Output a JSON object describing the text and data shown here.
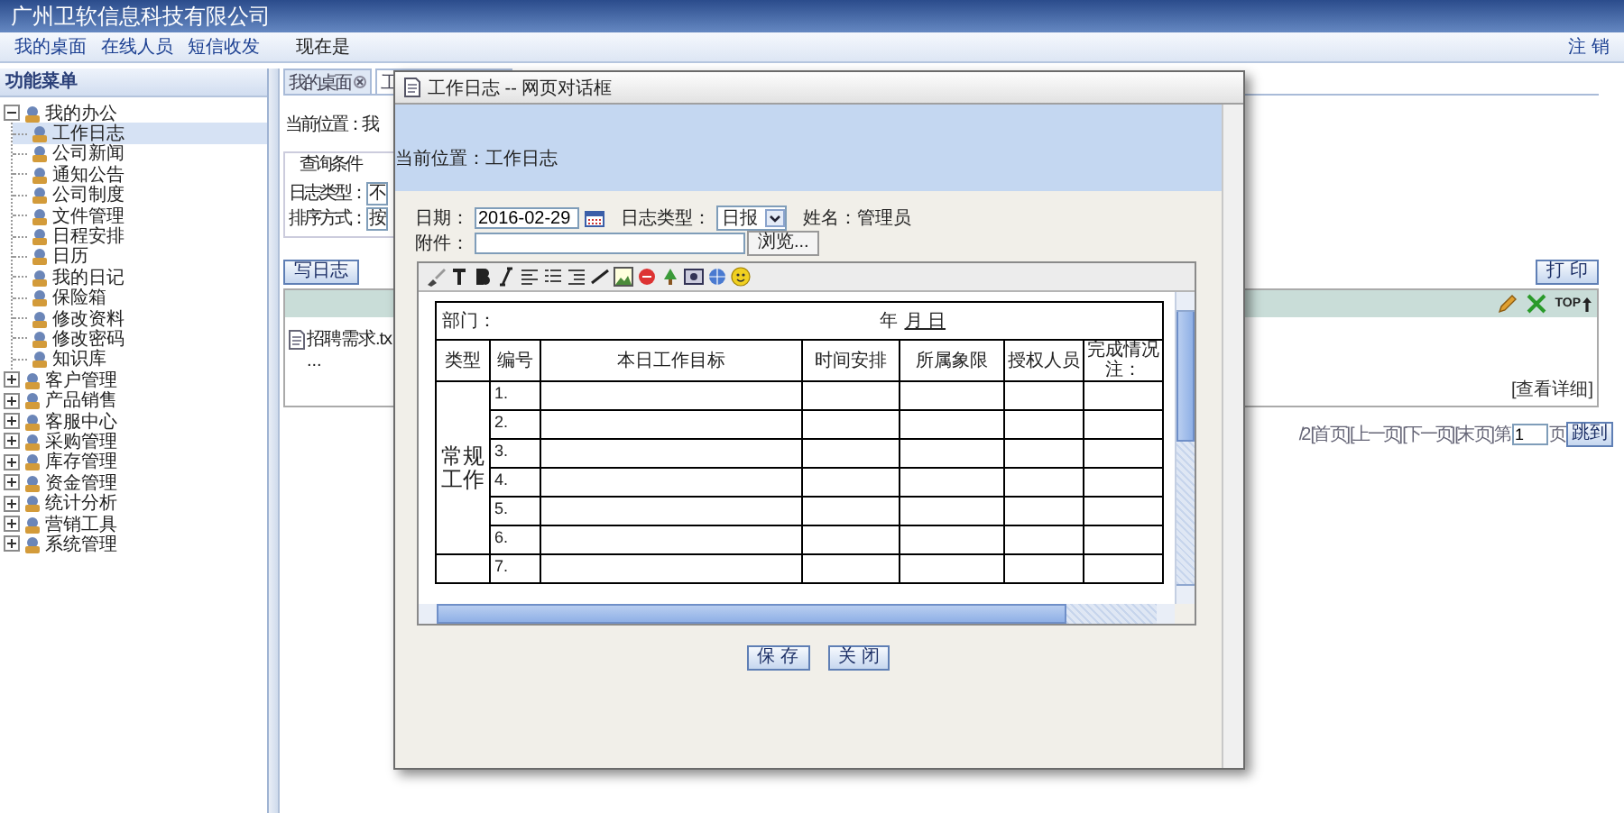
{
  "header": {
    "title": "广州卫软信息科技有限公司"
  },
  "nav": {
    "links": [
      "我的桌面",
      "在线人员",
      "短信收发"
    ],
    "clock_label": "现在是",
    "logout": "注 销"
  },
  "sidebar": {
    "title": "功能菜单",
    "items": [
      {
        "label": "我的办公",
        "expanded": true,
        "children": [
          {
            "label": "工作日志",
            "selected": true
          },
          {
            "label": "公司新闻",
            "selected": false
          },
          {
            "label": "通知公告",
            "selected": false
          },
          {
            "label": "公司制度",
            "selected": false
          },
          {
            "label": "文件管理",
            "selected": false
          },
          {
            "label": "日程安排",
            "selected": false
          },
          {
            "label": "日历",
            "selected": false
          },
          {
            "label": "我的日记",
            "selected": false
          },
          {
            "label": "保险箱",
            "selected": false
          },
          {
            "label": "修改资料",
            "selected": false
          },
          {
            "label": "修改密码",
            "selected": false
          },
          {
            "label": "知识库",
            "selected": false
          }
        ]
      },
      {
        "label": "客户管理",
        "expanded": false
      },
      {
        "label": "产品销售",
        "expanded": false
      },
      {
        "label": "客服中心",
        "expanded": false
      },
      {
        "label": "采购管理",
        "expanded": false
      },
      {
        "label": "库存管理",
        "expanded": false
      },
      {
        "label": "资金管理",
        "expanded": false
      },
      {
        "label": "统计分析",
        "expanded": false
      },
      {
        "label": "营销工具",
        "expanded": false
      },
      {
        "label": "系统管理",
        "expanded": false
      }
    ]
  },
  "tabs": [
    {
      "label": "我的桌面",
      "selected": false
    },
    {
      "label": "工",
      "selected": true
    }
  ],
  "breadcrumb": "当前位置：我",
  "query": {
    "legend": "查询条件",
    "fields": [
      {
        "label": "日志类型：",
        "value": "不"
      },
      {
        "label": "排序方式：",
        "value": "按"
      }
    ]
  },
  "write_button": "写日志",
  "print_button": "打 印",
  "log_entry": {
    "top_link": "TOP",
    "file": "招聘需求.tx",
    "more": "...",
    "details_link": "[查看详细]"
  },
  "pager": {
    "page_info": "/2",
    "links": [
      "[首 页]",
      "[上一页]",
      "[下一页]",
      "[末 页]"
    ],
    "page_prefix": "第",
    "page_value": "1",
    "page_suffix": "页",
    "go_button": "跳到"
  },
  "dialog": {
    "title": "工作日志 -- 网页对话框",
    "breadcrumb": "当前位置：工作日志",
    "date_label": "日期：",
    "date_value": "2016-02-29",
    "type_label": "日志类型：",
    "type_value": "日报",
    "name_text": "姓名：管理员",
    "attach_label": "附件：",
    "browse_button": "浏览...",
    "sheet": {
      "department_label": "部门：",
      "year_label": "年",
      "month_day_label": "月 日",
      "columns": [
        "类型",
        "编号",
        "本日工作目标",
        "时间安排",
        "所属象限",
        "授权人员",
        "完成情况注："
      ],
      "category": "常规工作",
      "rows": [
        "1.",
        "2.",
        "3.",
        "4.",
        "5.",
        "6.",
        "7."
      ]
    },
    "buttons": [
      "保 存",
      "关 闭"
    ]
  }
}
